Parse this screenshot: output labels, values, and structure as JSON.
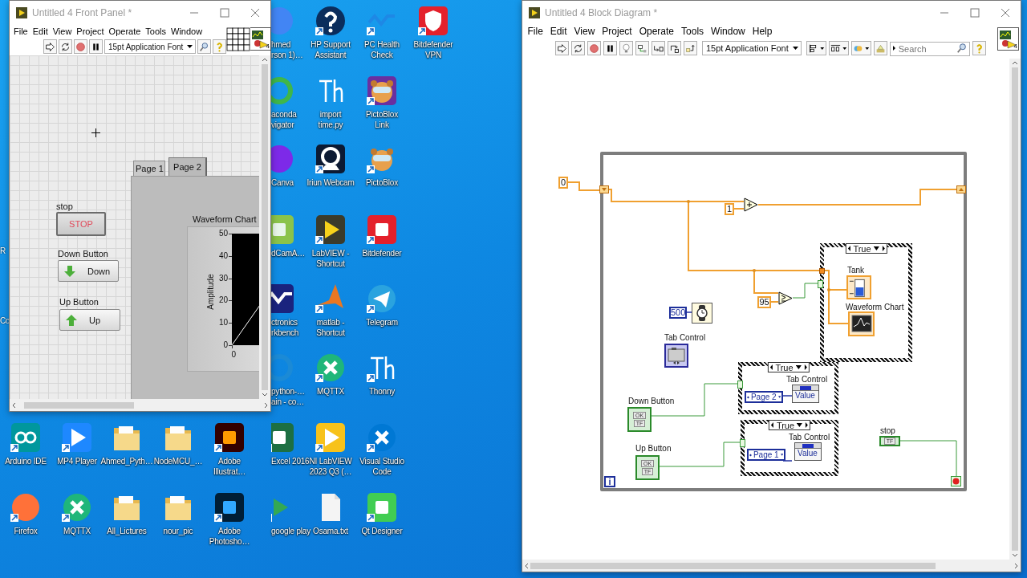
{
  "desktop": {
    "icons": [
      {
        "label": "hmed\nrson 1)…"
      },
      {
        "label": "HP Support\nAssistant"
      },
      {
        "label": "PC Health\nCheck"
      },
      {
        "label": "Bitdefender\nVPN"
      },
      {
        "label": "aconda\nvigator"
      },
      {
        "label": "import\ntime.py"
      },
      {
        "label": "PictoBlox\nLink"
      },
      {
        "label": "Canva"
      },
      {
        "label": "Iriun Webcam"
      },
      {
        "label": "PictoBlox"
      },
      {
        "label": "dCamA…"
      },
      {
        "label": "LabVIEW -\nShortcut"
      },
      {
        "label": "Bitdefender"
      },
      {
        "label": "ctronics\nrkbench"
      },
      {
        "label": "matlab -\nShortcut"
      },
      {
        "label": "Telegram"
      },
      {
        "label": "python-…\nain - co…"
      },
      {
        "label": "MQTTX"
      },
      {
        "label": "Thonny"
      },
      {
        "label": "Arduino IDE"
      },
      {
        "label": "MP4 Player"
      },
      {
        "label": "Ahmed_Pyth…"
      },
      {
        "label": "NodeMCU_…"
      },
      {
        "label": "Adobe\nIllustrat…"
      },
      {
        "label": "Excel 2016"
      },
      {
        "label": "NI LabVIEW\n2023 Q3 (…"
      },
      {
        "label": "Visual Studio\nCode"
      },
      {
        "label": "Firefox"
      },
      {
        "label": "MQTTX"
      },
      {
        "label": "All_Lictures"
      },
      {
        "label": "nour_pic"
      },
      {
        "label": "Adobe\nPhotosho…"
      },
      {
        "label": "google play"
      },
      {
        "label": "Osama.txt"
      },
      {
        "label": "Qt Designer"
      }
    ],
    "edge_fragments": [
      "R",
      "Co"
    ]
  },
  "front_panel": {
    "title": "Untitled 4 Front Panel *",
    "menu": [
      "File",
      "Edit",
      "View",
      "Project",
      "Operate",
      "Tools",
      "Window"
    ],
    "font": "15pt Application Font",
    "vi_icon_number": "4",
    "tab_control": {
      "tabs": [
        {
          "label": "Page 1",
          "selected": false
        },
        {
          "label": "Page 2",
          "selected": true
        }
      ]
    },
    "controls": [
      {
        "kind": "stop",
        "label": "stop",
        "text": "STOP"
      },
      {
        "kind": "down",
        "label": "Down Button",
        "text": "Down"
      },
      {
        "kind": "up",
        "label": "Up Button",
        "text": "Up"
      }
    ],
    "chart": {
      "label": "Waveform Chart",
      "y_axis_title": "Amplitude",
      "y_ticks": [
        "50",
        "40",
        "30",
        "20",
        "10",
        "0"
      ],
      "x_ticks": [
        "0"
      ]
    }
  },
  "block_diagram": {
    "title": "Untitled 4 Block Diagram *",
    "menu": [
      "File",
      "Edit",
      "View",
      "Project",
      "Operate",
      "Tools",
      "Window",
      "Help"
    ],
    "font": "15pt Application Font",
    "search": {
      "placeholder": "Search"
    },
    "vi_icon_number": "4",
    "constants": [
      {
        "kind": "dbl",
        "text": "0"
      },
      {
        "kind": "dbl",
        "text": "1"
      },
      {
        "kind": "dbl",
        "text": "95"
      },
      {
        "kind": "int",
        "text": "500"
      }
    ],
    "case_structures": [
      {
        "selector": "True"
      },
      {
        "selector": "True",
        "node_label": "Tab Control",
        "enum": "Page 2",
        "property": "Value"
      },
      {
        "selector": "True",
        "node_label": "Tab Control",
        "enum": "Page 1",
        "property": "Value"
      }
    ],
    "indicators": [
      {
        "kind": "tank",
        "label": "Tank"
      },
      {
        "kind": "chart",
        "label": "Waveform Chart"
      }
    ],
    "terminals": [
      {
        "kind": "tab",
        "label": "Tab Control"
      },
      {
        "kind": "button",
        "label": "Down Button",
        "glyph": "OK",
        "type": "TF"
      },
      {
        "kind": "button",
        "label": "Up Button",
        "glyph": "OK",
        "type": "TF"
      },
      {
        "kind": "bool",
        "label": "stop",
        "type": "TF"
      }
    ],
    "iteration_terminal": "i"
  }
}
